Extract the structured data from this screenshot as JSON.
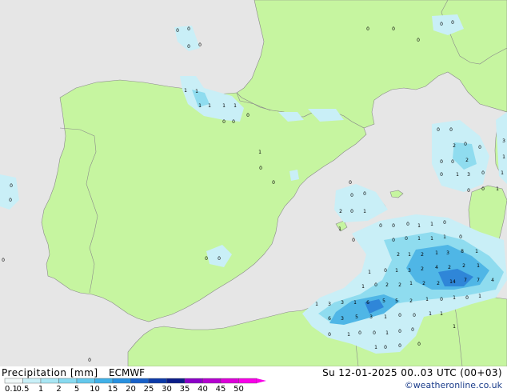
{
  "legend": {
    "title": "Precipitation [mm]",
    "model": "ECMWF",
    "valid_time": "Su 12-01-2025 00..03 UTC (00+03)",
    "credit": "©weatheronline.co.uk",
    "scale_labels": [
      "0.1",
      "0.5",
      "1",
      "2",
      "5",
      "10",
      "15",
      "20",
      "25",
      "30",
      "35",
      "40",
      "45",
      "50"
    ],
    "scale_colors": [
      "#f0f8f8",
      "#c8f0f8",
      "#a8e6f4",
      "#88daf0",
      "#64c8ec",
      "#40b0e8",
      "#2890e0",
      "#1860c8",
      "#0c3aa8",
      "#0a1c88",
      "#8a00c8",
      "#b400d0",
      "#dc00d8",
      "#f800e8"
    ]
  },
  "colors": {
    "sea": "#e6e6e6",
    "land": "#c6f5a0",
    "border": "#8a8a8a",
    "precip_light": "#c9eff7",
    "precip_mid": "#8fdcef",
    "precip_strong": "#4fb6e6",
    "precip_heavy": "#2f86d8"
  },
  "labels": {
    "values": [
      "0",
      "1",
      "2",
      "3",
      "4",
      "5",
      "6",
      "7",
      "8",
      "14"
    ]
  }
}
